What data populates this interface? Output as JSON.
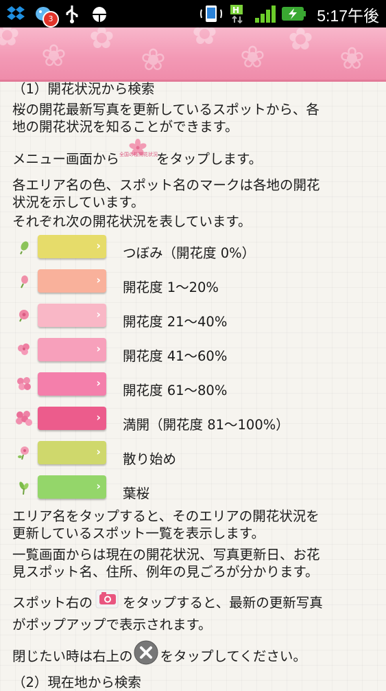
{
  "status_bar": {
    "notification_count": "3",
    "time": "5:17午後",
    "icons": [
      "dropbox-icon",
      "notification-badge-icon",
      "usb-icon",
      "android-debug-icon",
      "phone-sync-icon",
      "hsdpa-icon",
      "signal-icon",
      "battery-charging-icon"
    ]
  },
  "section1": {
    "heading": "（1）開花状況から検索",
    "intro_line1": "桜の開花最新写真を更新しているスポットから、各",
    "intro_line2": "地の開花状況を知ることができます。",
    "menu_before": "メニュー画面から",
    "menu_icon_caption": "全国の桜開花状況",
    "menu_after": "をタップします。",
    "color_line1": "各エリア名の色、スポット名のマークは各地の開花",
    "color_line2": "状況を示しています。",
    "legend_intro": "それぞれ次の開花状況を表しています。"
  },
  "legend": [
    {
      "label": "つぼみ（開花度 0%）",
      "color": "#e6dc6a",
      "icon": "bud-icon"
    },
    {
      "label": "開花度 1〜20%",
      "color": "#f9b19b",
      "icon": "bloom-1-icon"
    },
    {
      "label": "開花度 21〜40%",
      "color": "#f9b7c6",
      "icon": "bloom-2-icon"
    },
    {
      "label": "開花度 41〜60%",
      "color": "#f7a0bb",
      "icon": "bloom-3-icon"
    },
    {
      "label": "開花度 61〜80%",
      "color": "#f47fab",
      "icon": "bloom-4-icon"
    },
    {
      "label": "満開（開花度 81〜100%）",
      "color": "#ec5c8c",
      "icon": "full-bloom-icon"
    },
    {
      "label": "散り始め",
      "color": "#cfd86c",
      "icon": "falling-petals-icon"
    },
    {
      "label": "葉桜",
      "color": "#94d66a",
      "icon": "leaf-cherry-icon"
    }
  ],
  "after_legend": {
    "area_line1": "エリア名をタップすると、そのエリアの開花状況を",
    "area_line2": "更新しているスポット一覧を表示します。",
    "list_line1": "一覧画面からは現在の開花状況、写真更新日、お花",
    "list_line2": "見スポット名、住所、例年の見ごろが分かります。",
    "spot_before": "スポット右の",
    "spot_after": "をタップすると、最新の更新写真",
    "spot_line2": "がポップアップで表示されます。",
    "close_before": "閉じたい時は右上の",
    "close_after": "をタップしてください。"
  },
  "section2": {
    "heading": "（2）現在地から検索"
  }
}
